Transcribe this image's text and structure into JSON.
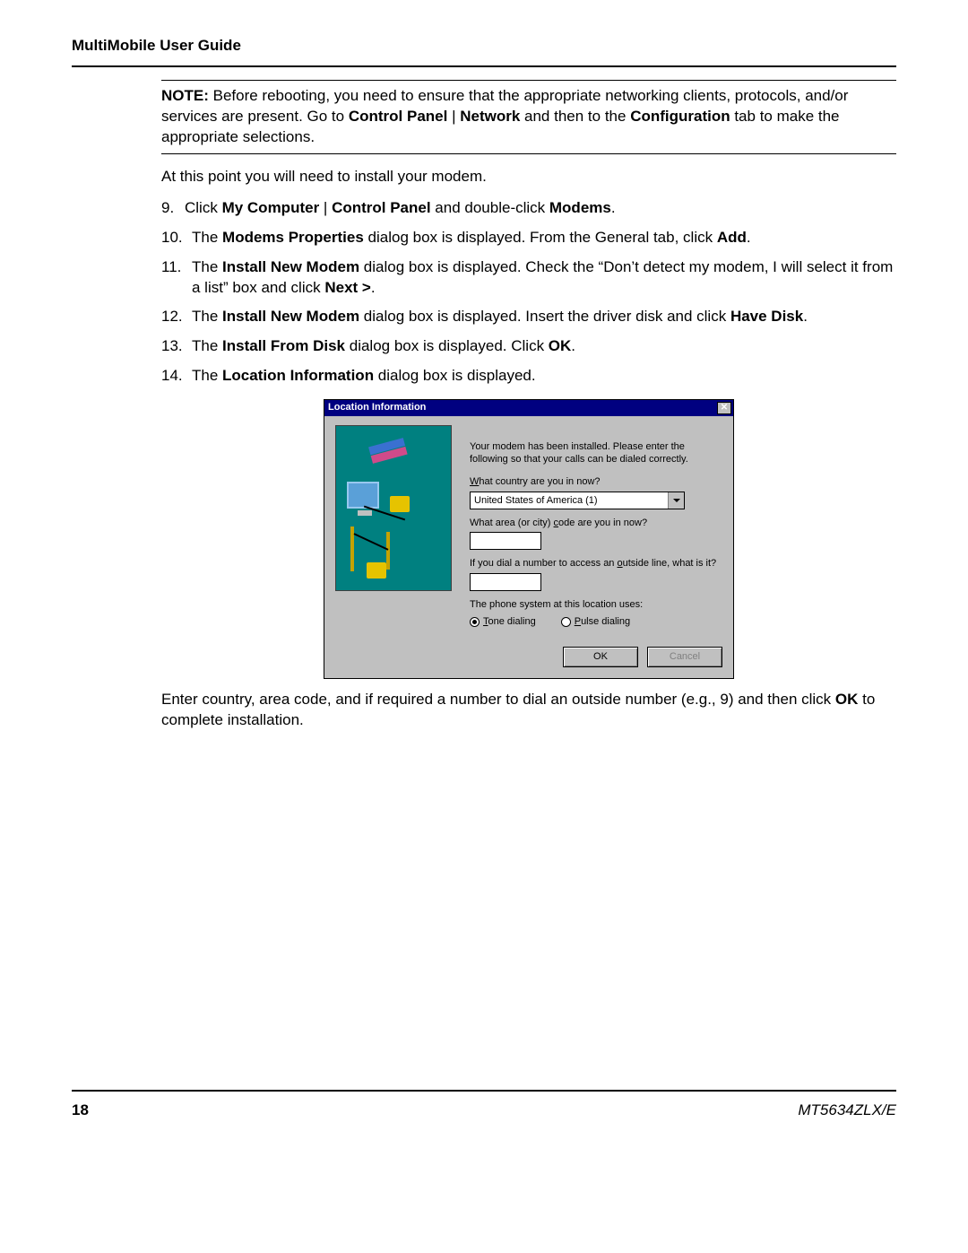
{
  "doc": {
    "header": "MultiMobile User Guide",
    "page_number": "18",
    "model": "MT5634ZLX/E"
  },
  "note": {
    "label": "NOTE:",
    "text_a": " Before rebooting, you need to ensure that the appropriate networking clients, protocols, and/or services are present. Go to ",
    "bold_b": "Control Panel",
    "sep_b": " | ",
    "bold_c": "Network",
    "text_d": "  and then to the ",
    "bold_e": "Configuration",
    "text_f": " tab to make the appropriate selections."
  },
  "lead": "At this point you will need to install your modem.",
  "steps": [
    {
      "num": "9.",
      "parts": [
        {
          "t": "Click "
        },
        {
          "b": "My Computer"
        },
        {
          "t": " | "
        },
        {
          "b": "Control Panel"
        },
        {
          "t": " and double-click "
        },
        {
          "b": "Modems"
        },
        {
          "t": "."
        }
      ]
    },
    {
      "num": "10.",
      "parts": [
        {
          "t": "The "
        },
        {
          "b": "Modems Properties"
        },
        {
          "t": " dialog box is displayed. From the General tab, click "
        },
        {
          "b": "Add"
        },
        {
          "t": "."
        }
      ]
    },
    {
      "num": "11.",
      "parts": [
        {
          "t": "The "
        },
        {
          "b": "Install New Modem"
        },
        {
          "t": " dialog box is displayed. Check the “Don’t detect my modem, I will select it from a list” box and click "
        },
        {
          "b": "Next >"
        },
        {
          "t": "."
        }
      ]
    },
    {
      "num": "12.",
      "parts": [
        {
          "t": "The "
        },
        {
          "b": "Install New Modem"
        },
        {
          "t": " dialog box is displayed. Insert the driver disk and click "
        },
        {
          "b": "Have Disk"
        },
        {
          "t": "."
        }
      ]
    },
    {
      "num": "13.",
      "parts": [
        {
          "t": "The "
        },
        {
          "b": "Install From Disk"
        },
        {
          "t": " dialog box is displayed. Click "
        },
        {
          "b": "OK"
        },
        {
          "t": "."
        }
      ]
    },
    {
      "num": "14.",
      "parts": [
        {
          "t": "The "
        },
        {
          "b": "Location Information"
        },
        {
          "t": " dialog box is displayed."
        }
      ]
    }
  ],
  "dialog": {
    "title": "Location Information",
    "close_glyph": "✕",
    "intro": "Your modem has been installed.  Please enter the following so that your calls can be dialed correctly.",
    "q_country_pre": "W",
    "q_country_rest": "hat country are you in now?",
    "country_value": "United States of America (1)",
    "q_area_pre": "What area (or city) ",
    "q_area_u": "c",
    "q_area_rest": "ode are you in now?",
    "q_outside_pre": "If you dial a number to access an ",
    "q_outside_u": "o",
    "q_outside_rest": "utside line, what is it?",
    "q_phone_sys": "The phone system at this location uses:",
    "radio_tone_u": "T",
    "radio_tone_rest": "one dialing",
    "radio_pulse_u": "P",
    "radio_pulse_rest": "ulse dialing",
    "btn_ok": "OK",
    "btn_cancel": "Cancel"
  },
  "trail": {
    "text_a": "Enter country, area code, and if required a number to dial an outside number (e.g., 9) and then click ",
    "bold_b": "OK",
    "text_c": " to complete installation."
  }
}
